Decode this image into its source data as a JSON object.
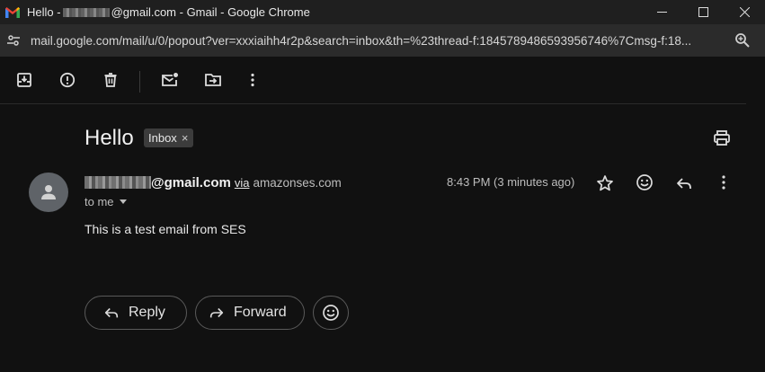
{
  "window": {
    "title_prefix": "Hello -",
    "title_suffix": "@gmail.com - Gmail - Google Chrome",
    "controls": [
      "minimize-icon",
      "maximize-icon",
      "close-icon"
    ]
  },
  "address": {
    "url": "mail.google.com/mail/u/0/popout?ver=xxxiaihh4r2p&search=inbox&th=%23thread-f:1845789486593956746%7Cmsg-f:18..."
  },
  "toolbar": {
    "icons": [
      "archive-icon",
      "report-spam-icon",
      "delete-icon",
      "mark-unread-icon",
      "move-to-icon",
      "more-options-icon"
    ]
  },
  "email": {
    "subject": "Hello",
    "label": "Inbox",
    "label_remove": "×",
    "sender_domain": "@gmail.com",
    "via": "via",
    "via_domain": "amazonses.com",
    "recipient": "to me",
    "time": "8:43 PM (3 minutes ago)",
    "body": "This is a test email from SES"
  },
  "actions": {
    "reply": "Reply",
    "forward": "Forward"
  },
  "colors": {
    "background": "#111111",
    "titlebar": "#1f1f1f",
    "addressbar": "#2b2b2b",
    "chip": "#3c3c3c",
    "avatar": "#5f6368"
  }
}
